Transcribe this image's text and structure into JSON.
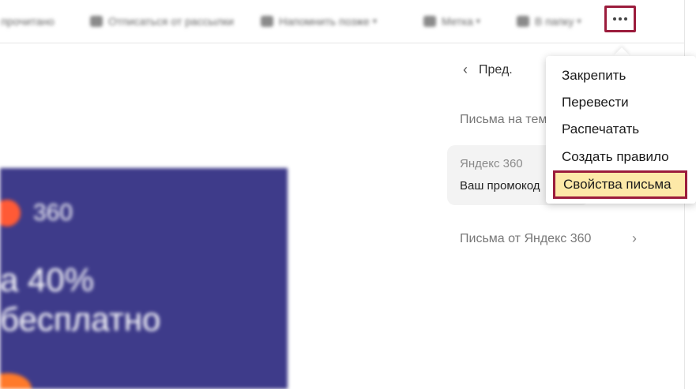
{
  "toolbar": {
    "items": [
      {
        "label": "в прочитано",
        "icon": "read-icon",
        "has_caret": false
      },
      {
        "label": "Отписаться от рассылки",
        "icon": "unsubscribe-icon",
        "has_caret": false
      },
      {
        "label": "Напомнить позже",
        "icon": "remind-icon",
        "has_caret": true
      },
      {
        "label": "Метка",
        "icon": "tag-icon",
        "has_caret": true
      },
      {
        "label": "В папку",
        "icon": "folder-icon",
        "has_caret": true
      }
    ],
    "more_icon": "more-horizontal-icon"
  },
  "banner": {
    "logo_text": "360",
    "line1": "а 40%",
    "line2": "бесплатно"
  },
  "navigation": {
    "prev_label": "Пред."
  },
  "thread": {
    "header": "Письма на тему",
    "sender": "Яндекс 360",
    "subject": "Ваш промокод"
  },
  "from_link": {
    "label": "Письма от Яндекс 360"
  },
  "menu": {
    "items": [
      {
        "label": "Закрепить"
      },
      {
        "label": "Перевести"
      },
      {
        "label": "Распечатать"
      },
      {
        "label": "Создать правило"
      },
      {
        "label": "Свойства письма",
        "highlighted": true
      }
    ]
  },
  "colors": {
    "highlight_border": "#9b1c3c",
    "highlight_fill": "#fde9a8",
    "banner_bg": "#3e3b8a"
  }
}
